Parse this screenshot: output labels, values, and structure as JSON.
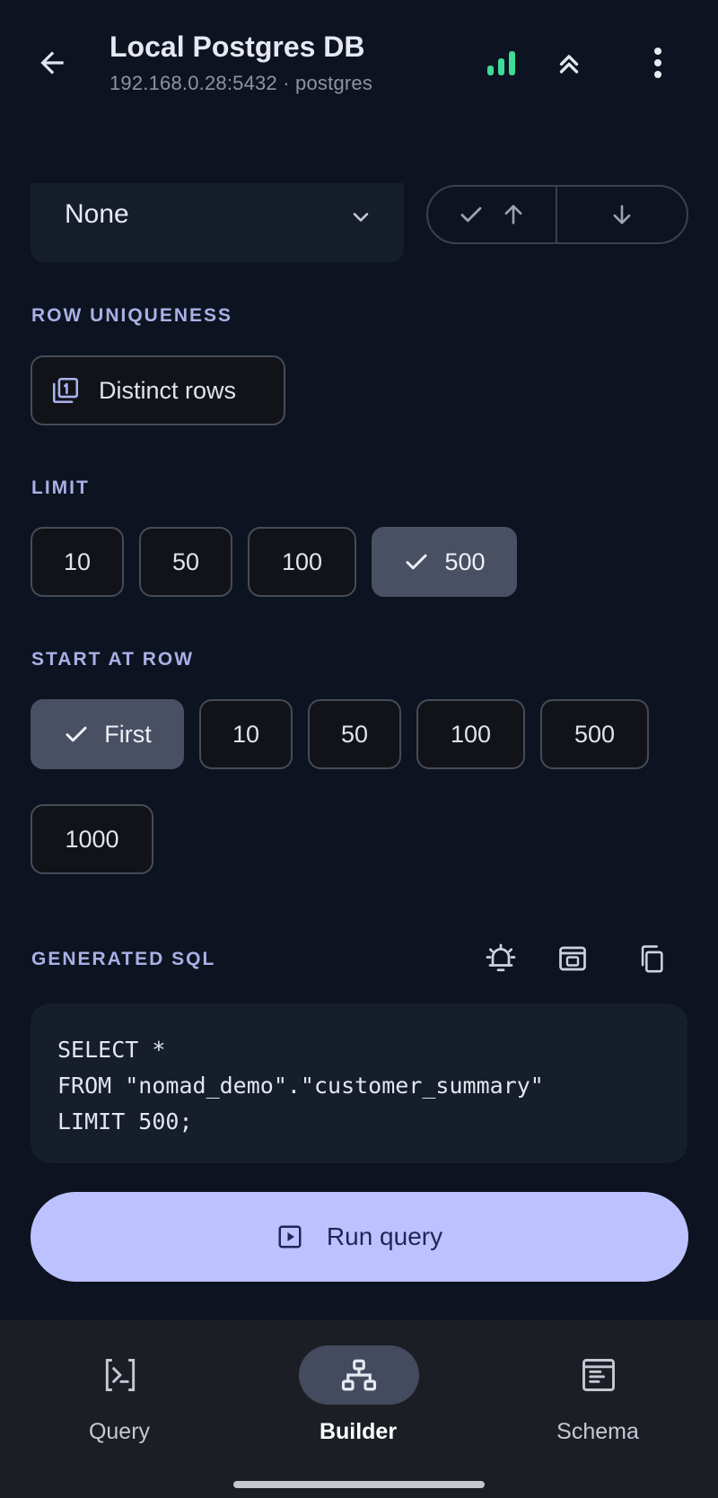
{
  "header": {
    "title": "Local Postgres DB",
    "subtitle": "192.168.0.28:5432 · postgres",
    "icons": [
      "arrow-back-icon",
      "signal-bars-icon",
      "double-chevron-up-icon",
      "more-vert-icon"
    ],
    "signal_color": "#3ddc97"
  },
  "sort": {
    "column_value": "None",
    "order_options": [
      "ascending",
      "descending"
    ]
  },
  "row_uniqueness": {
    "label": "ROW UNIQUENESS",
    "option": "Distinct rows"
  },
  "limit": {
    "label": "LIMIT",
    "options": [
      "10",
      "50",
      "100",
      "500"
    ],
    "selected": "500"
  },
  "start_at_row": {
    "label": "START AT ROW",
    "options": [
      "First",
      "10",
      "50",
      "100",
      "500",
      "1000"
    ],
    "selected": "First"
  },
  "generated_sql": {
    "label": "GENERATED SQL",
    "lines": [
      "SELECT *",
      "FROM \"nomad_demo\".\"customer_summary\"",
      "LIMIT 500;"
    ],
    "action_icons": [
      "alarm-icon",
      "save-query-icon",
      "copy-icon"
    ]
  },
  "run_button": {
    "label": "Run query"
  },
  "nav": {
    "items": [
      {
        "label": "Query",
        "icon": "terminal-icon"
      },
      {
        "label": "Builder",
        "icon": "flowchart-icon"
      },
      {
        "label": "Schema",
        "icon": "schema-icon"
      }
    ],
    "active": "Builder"
  },
  "colors": {
    "background": "#0d1320",
    "surface": "#161d2b",
    "accent": "#bcc2ff",
    "section_label": "#a9b0e6",
    "selected_chip": "#4a5064"
  }
}
